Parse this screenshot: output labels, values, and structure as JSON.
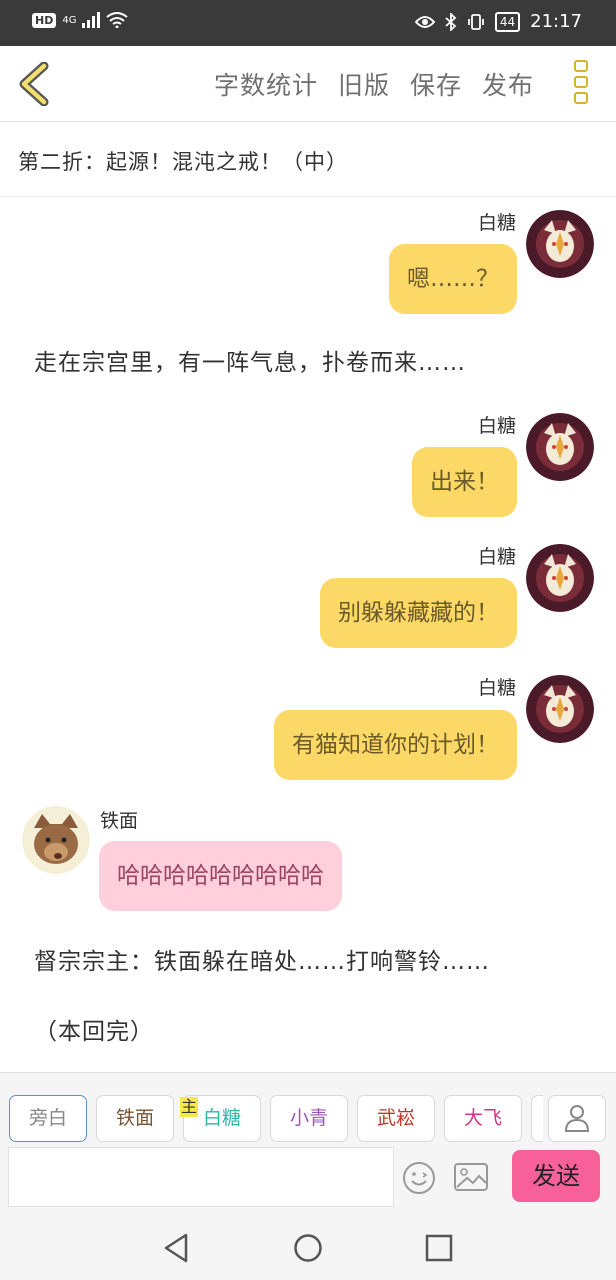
{
  "status_bar": {
    "network_badge": "HD",
    "network_type": "4G",
    "battery": "44",
    "time": "21:17"
  },
  "toolbar": {
    "word_count": "字数统计",
    "old_version": "旧版",
    "save": "保存",
    "publish": "发布"
  },
  "chapter_title": "第二折：起源！混沌之戒！（中）",
  "messages": [
    {
      "speaker": "白糖",
      "text": "嗯……？"
    },
    {
      "narration": "走在宗宫里，有一阵气息，扑卷而来……"
    },
    {
      "speaker": "白糖",
      "text": "出来！"
    },
    {
      "speaker": "白糖",
      "text": "别躲躲藏藏的！"
    },
    {
      "speaker": "白糖",
      "text": "有猫知道你的计划！"
    },
    {
      "speaker": "铁面",
      "text": "哈哈哈哈哈哈哈哈哈"
    },
    {
      "narration": "督宗宗主：铁面躲在暗处……打响警铃……"
    },
    {
      "narration": "（本回完）"
    }
  ],
  "roles": [
    {
      "label": "旁白",
      "color": "#888888"
    },
    {
      "label": "铁面",
      "color": "#7a5535"
    },
    {
      "label": "白糖",
      "color": "#2fb8a8"
    },
    {
      "label": "小青",
      "color": "#9b59b6"
    },
    {
      "label": "武崧",
      "color": "#c0392b"
    },
    {
      "label": "大飞",
      "color": "#d63384"
    }
  ],
  "main_role_tag": "主",
  "send_label": "发送",
  "input_placeholder": ""
}
